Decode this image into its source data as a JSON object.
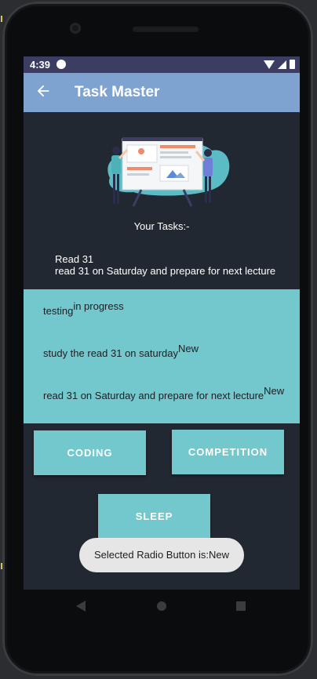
{
  "status_bar": {
    "time": "4:39"
  },
  "app_bar": {
    "title": "Task Master"
  },
  "header": {
    "your_tasks": "Your Tasks:-"
  },
  "task_detail": {
    "title": "Read 31",
    "description": "read 31 on Saturday and prepare for next lecture"
  },
  "task_list": [
    {
      "title": "testing",
      "status": "in progress"
    },
    {
      "title": "study the read 31 on saturday",
      "status": "New"
    },
    {
      "title": "read 31 on Saturday and prepare for next lecture",
      "status": "New"
    }
  ],
  "buttons": {
    "coding": "CODING",
    "competition": "COMPETITION",
    "sleep": "SLEEP"
  },
  "toast": {
    "message": "Selected Radio Button is:New"
  },
  "colors": {
    "app_bar": "#7ea3d1",
    "accent": "#72c8cc",
    "background": "#222831",
    "status_bar": "#3b3d63"
  }
}
